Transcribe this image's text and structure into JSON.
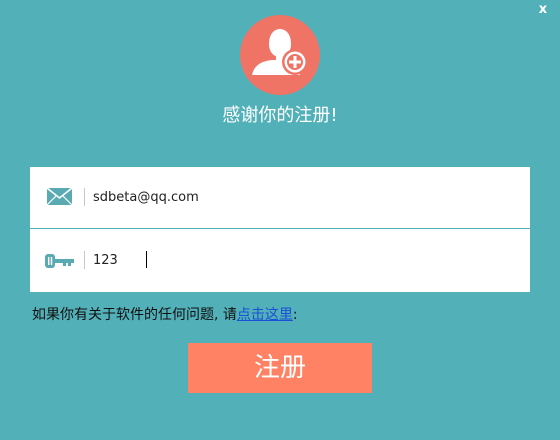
{
  "window": {
    "close_label": "x",
    "background_color": "#52b0b8"
  },
  "header": {
    "avatar_icon": "user-add-icon",
    "avatar_color": "#ef7466",
    "title": "感谢你的注册!"
  },
  "form": {
    "email": {
      "icon": "envelope-icon",
      "value": "sdbeta@qq.com"
    },
    "password": {
      "icon": "key-icon",
      "value": "123"
    }
  },
  "help": {
    "prefix": "如果你有关于软件的任何问题, 请",
    "link_label": "点击这里",
    "suffix": ":"
  },
  "submit": {
    "label": "注册",
    "color": "#ff8264"
  }
}
